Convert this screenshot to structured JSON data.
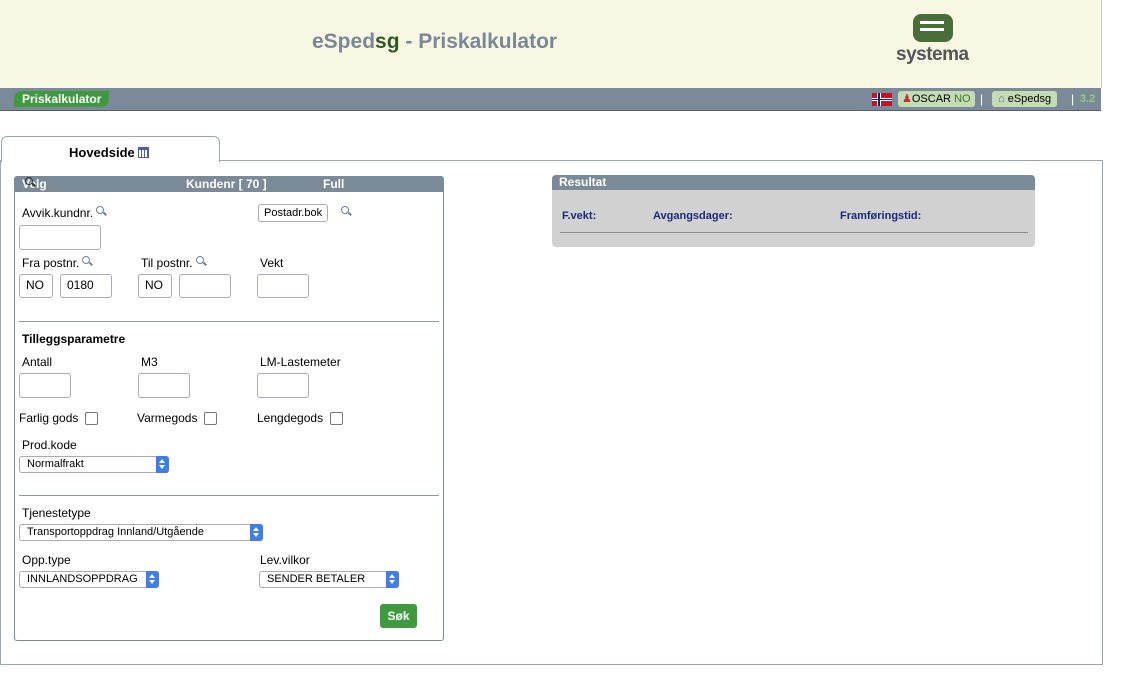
{
  "header": {
    "title_prefix": "eSped",
    "title_accent": "sg",
    "title_suffix": " - Priskalkulator",
    "logo_word": "systema"
  },
  "navbar": {
    "active_tab": "Priskalkulator",
    "user": "OSCAR",
    "country": "NO",
    "home_label": "eSpedsg",
    "separator": "|",
    "version": "3.2"
  },
  "main_tab": {
    "label": "Hovedside"
  },
  "search_panel": {
    "header_left": "Velg søkebegrep",
    "header_mid": "Kundenr [ 70 ]",
    "header_right": "Full fakturaberegning",
    "avvik_label": "Avvik.kundnr.",
    "avvik_value": "",
    "postadr_button": "Postadr.bok",
    "fra_label": "Fra postnr.",
    "fra_country": "NO",
    "fra_postnr": "0180",
    "til_label": "Til postnr.",
    "til_country": "NO",
    "til_postnr": "",
    "vekt_label": "Vekt",
    "vekt_value": ""
  },
  "tillegg": {
    "title": "Tilleggsparametre",
    "antall_label": "Antall",
    "m3_label": "M3",
    "lm_label": "LM-Lastemeter",
    "farlig_label": "Farlig gods",
    "varme_label": "Varmegods",
    "lengde_label": "Lengdegods",
    "prodkode_label": "Prod.kode",
    "prodkode_value": "Normalfrakt"
  },
  "tjeneste": {
    "title": "Tjenestetype",
    "value": "Transportoppdrag Innland/Utgående",
    "opptype_label": "Opp.type",
    "opptype_value": "INNLANDSOPPDRAG",
    "levvilkor_label": "Lev.vilkor",
    "levvilkor_value": "SENDER BETALER",
    "search_button": "Søk"
  },
  "result": {
    "title": "Resultat",
    "fvekt": "F.vekt:",
    "avgang": "Avgangsdager:",
    "framforing": "Framføringstid:"
  },
  "colors": {
    "accent_green": "#3f9a3f",
    "bar_gray": "#7b8a98",
    "banner_bg": "#f7f7e3",
    "result_label": "#1a2a7a"
  }
}
